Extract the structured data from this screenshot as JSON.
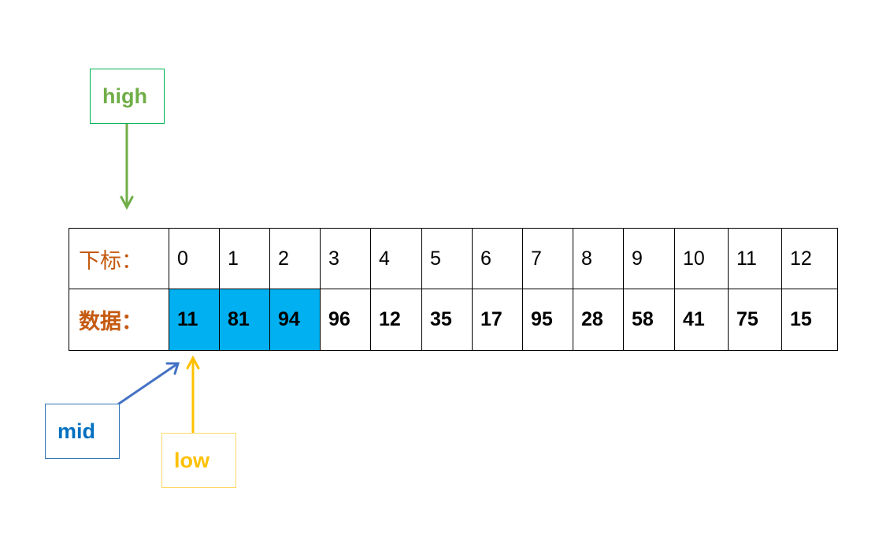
{
  "table": {
    "index_header": "下标：",
    "value_header": "数据：",
    "indices": [
      "0",
      "1",
      "2",
      "3",
      "4",
      "5",
      "6",
      "7",
      "8",
      "9",
      "10",
      "11",
      "12"
    ],
    "values": [
      "11",
      "81",
      "94",
      "96",
      "12",
      "35",
      "17",
      "95",
      "28",
      "58",
      "41",
      "75",
      "15"
    ],
    "highlighted_indices": [
      0,
      1,
      2
    ],
    "highlight_color": "#00b0f0",
    "header_color": "#c55a11"
  },
  "pointers": {
    "high": {
      "label": "high",
      "points_to_index": 0,
      "color": "#70ad47",
      "direction": "down"
    },
    "mid": {
      "label": "mid",
      "points_to_index": 0,
      "color": "#4472c4",
      "direction": "up-right"
    },
    "low": {
      "label": "low",
      "points_to_index": 0,
      "color": "#ffc000",
      "direction": "up"
    }
  }
}
